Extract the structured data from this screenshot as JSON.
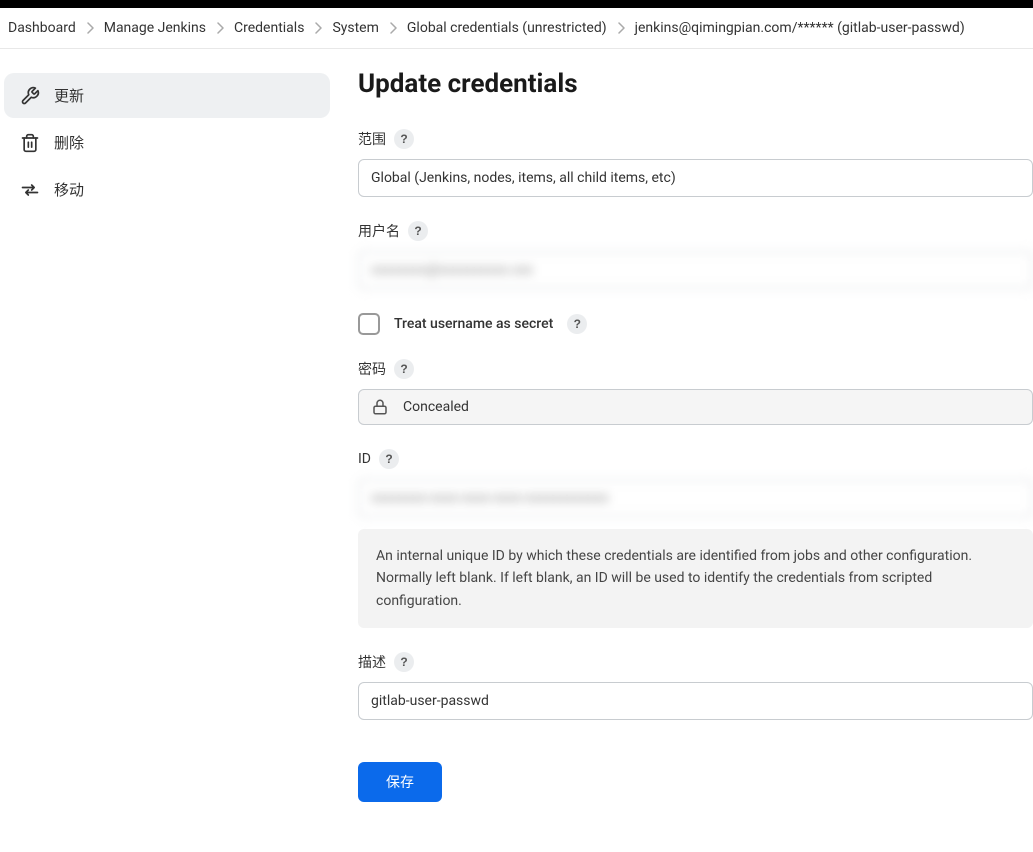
{
  "breadcrumb": [
    {
      "label": "Dashboard"
    },
    {
      "label": "Manage Jenkins"
    },
    {
      "label": "Credentials"
    },
    {
      "label": "System"
    },
    {
      "label": "Global credentials (unrestricted)"
    },
    {
      "label": "jenkins@qimingpian.com/****** (gitlab-user-passwd)"
    }
  ],
  "sidebar": {
    "items": [
      {
        "label": "更新",
        "active": true,
        "icon": "wrench"
      },
      {
        "label": "删除",
        "active": false,
        "icon": "trash"
      },
      {
        "label": "移动",
        "active": false,
        "icon": "swap"
      }
    ]
  },
  "page": {
    "title": "Update credentials"
  },
  "form": {
    "scope": {
      "label": "范围",
      "value": "Global (Jenkins, nodes, items, all child items, etc)"
    },
    "username": {
      "label": "用户名",
      "value": "xxxxxxxx@xxxxxxxxxx.xxx"
    },
    "treat_secret": {
      "label": "Treat username as secret",
      "checked": false
    },
    "password": {
      "label": "密码",
      "display": "Concealed"
    },
    "id": {
      "label": "ID",
      "value": "xxxxxxxx-xxxx-xxxx-xxxx-xxxxxxxxxxxx",
      "help_text": "An internal unique ID by which these credentials are identified from jobs and other configuration. Normally left blank. If left blank, an ID will be used to identify the credentials from scripted configuration."
    },
    "description": {
      "label": "描述",
      "value": "gitlab-user-passwd"
    },
    "save_label": "保存"
  }
}
